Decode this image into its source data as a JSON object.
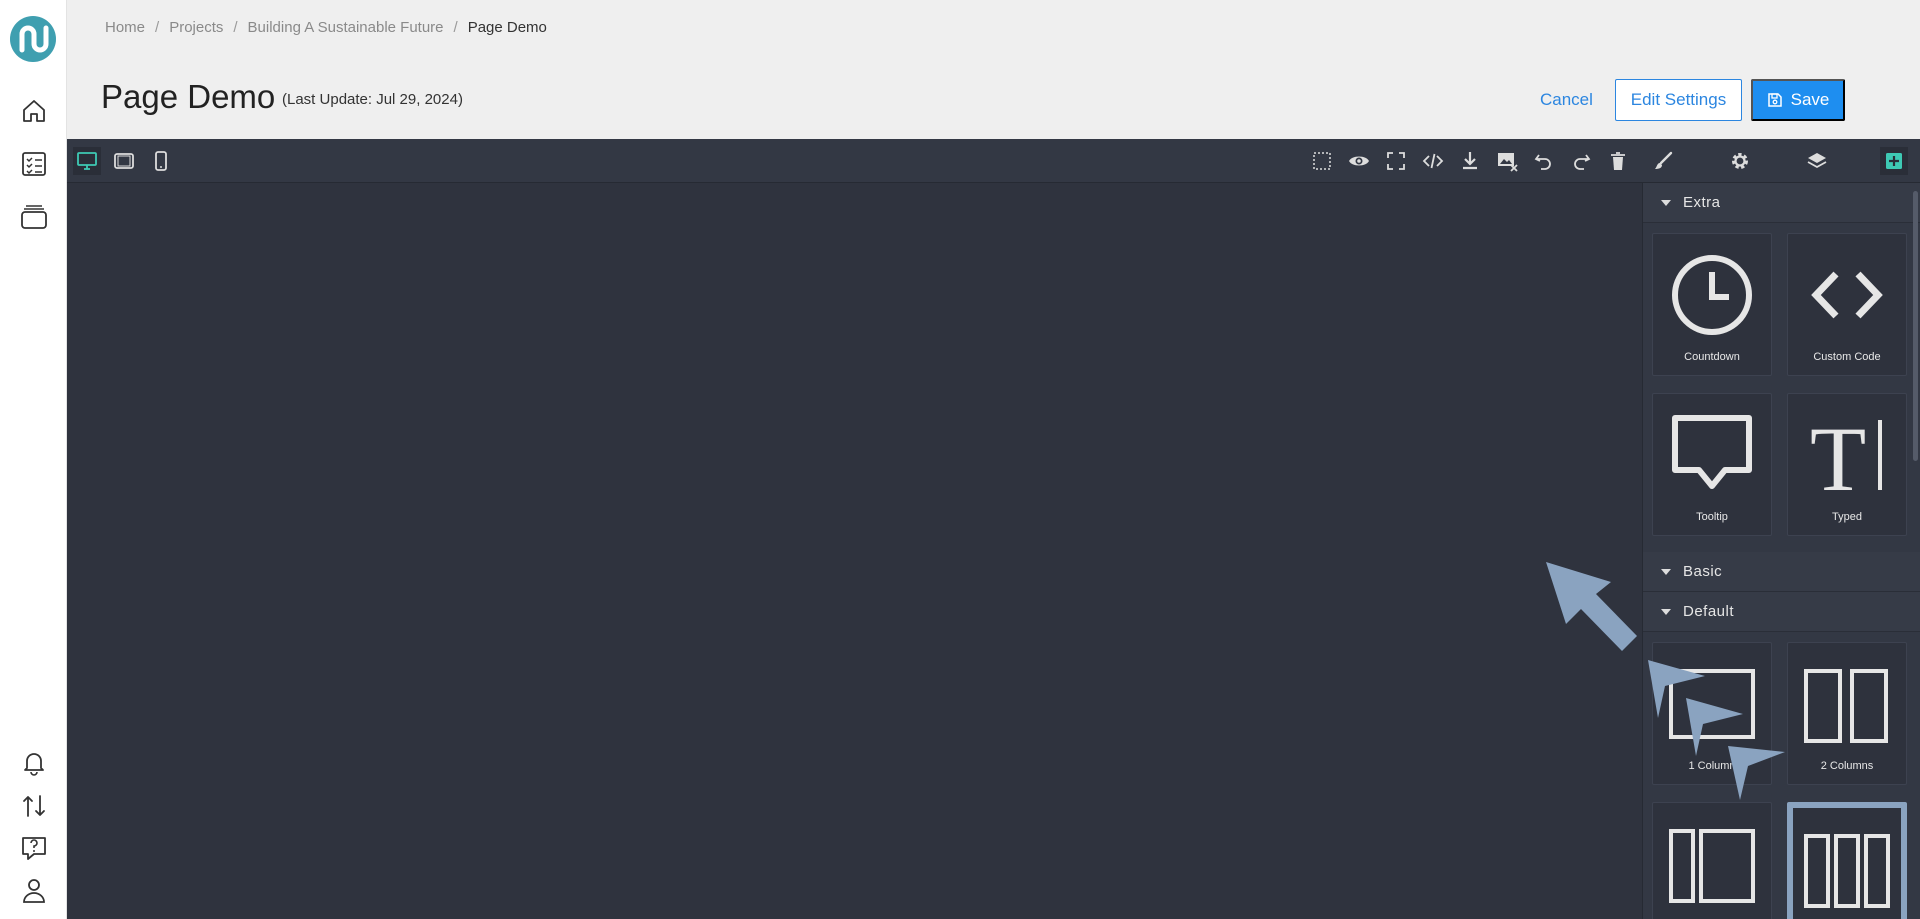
{
  "breadcrumb": {
    "items": [
      "Home",
      "Projects",
      "Building A Sustainable Future"
    ],
    "current": "Page Demo",
    "separator": "/"
  },
  "page": {
    "title": "Page Demo",
    "last_update": "(Last Update: Jul 29, 2024)"
  },
  "actions": {
    "cancel": "Cancel",
    "edit_settings": "Edit Settings",
    "save": "Save"
  },
  "sidebar": {
    "icons": [
      "logo-icon",
      "home-icon",
      "checklist-icon",
      "layers-stack-icon",
      "bell-icon",
      "transfer-icon",
      "help-icon",
      "user-icon"
    ]
  },
  "toolbar": {
    "devices": [
      "desktop-icon",
      "tablet-icon",
      "mobile-icon"
    ],
    "tools": [
      "select-outline-icon",
      "preview-icon",
      "fullscreen-icon",
      "code-icon",
      "download-icon",
      "clear-images-icon",
      "undo-icon",
      "redo-icon",
      "trash-icon"
    ],
    "panels": [
      "style-manager-icon",
      "settings-icon",
      "layer-manager-icon",
      "blocks-icon"
    ]
  },
  "panel": {
    "categories": {
      "extra": "Extra",
      "basic": "Basic",
      "default": "Default"
    },
    "extra_blocks": [
      {
        "label": "Countdown",
        "icon": "clock-icon"
      },
      {
        "label": "Custom Code",
        "icon": "code-brackets-icon"
      },
      {
        "label": "Tooltip",
        "icon": "speech-bubble-icon"
      },
      {
        "label": "Typed",
        "icon": "text-cursor-icon"
      }
    ],
    "default_blocks": [
      {
        "label": "1 Column",
        "icon": "one-column-icon"
      },
      {
        "label": "2 Columns",
        "icon": "two-columns-icon"
      },
      {
        "label": "",
        "icon": "column-3-7-icon"
      },
      {
        "label": "",
        "icon": "three-columns-icon"
      }
    ]
  },
  "colors": {
    "accent": "#1e8ef0",
    "editor_bg": "#2f333e",
    "panel_bg": "#333844",
    "active_icon": "#3ec9b4",
    "annotation": "#8aa3c0"
  }
}
